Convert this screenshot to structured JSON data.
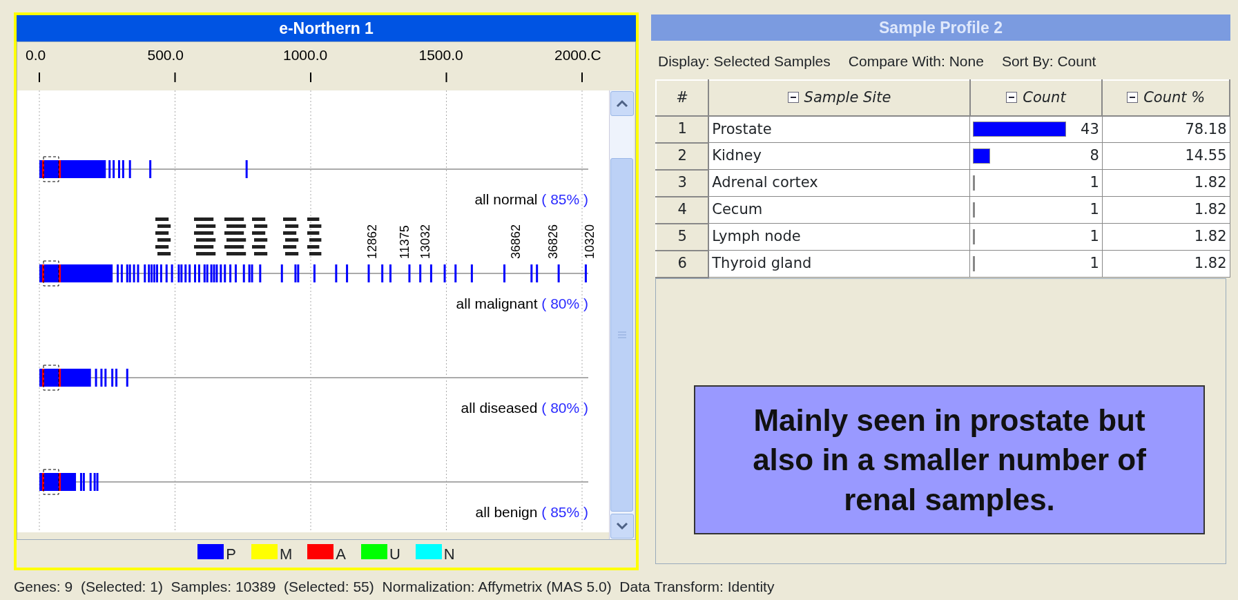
{
  "left_panel": {
    "title": "e-Northern 1",
    "selected": true,
    "axis_ticks": [
      "0.0",
      "500.0",
      "1000.0",
      "1500.0",
      "2000.C"
    ],
    "rows": [
      {
        "label": "all normal",
        "percent": "( 85% )"
      },
      {
        "label": "all malignant",
        "percent": "( 80% )"
      },
      {
        "label": "all diseased",
        "percent": "( 80% )"
      },
      {
        "label": "all benign",
        "percent": "( 85% )"
      }
    ],
    "point_labels": [
      "12862",
      "11375",
      "13032",
      "36862",
      "36826",
      "10320"
    ],
    "legend": [
      {
        "label": "P",
        "color": "#0000ff"
      },
      {
        "label": "M",
        "color": "#ffff00"
      },
      {
        "label": "A",
        "color": "#ff0000"
      },
      {
        "label": "U",
        "color": "#00ff00"
      },
      {
        "label": "N",
        "color": "#00ffff"
      }
    ]
  },
  "right_panel": {
    "title": "Sample Profile 2",
    "selected": false,
    "options": [
      "Display: Selected Samples",
      "Compare With: None",
      "Sort By: Count"
    ],
    "columns": [
      "#",
      "Sample Site",
      "Count",
      "Count %"
    ],
    "rows": [
      {
        "index": "1",
        "site": "Prostate",
        "count": "43",
        "percent": "78.18"
      },
      {
        "index": "2",
        "site": "Kidney",
        "count": "8",
        "percent": "14.55"
      },
      {
        "index": "3",
        "site": "Adrenal cortex",
        "count": "1",
        "percent": "1.82"
      },
      {
        "index": "4",
        "site": "Cecum",
        "count": "1",
        "percent": "1.82"
      },
      {
        "index": "5",
        "site": "Lymph node",
        "count": "1",
        "percent": "1.82"
      },
      {
        "index": "6",
        "site": "Thyroid gland",
        "count": "1",
        "percent": "1.82"
      }
    ]
  },
  "callout": "Mainly seen in prostate but also in a smaller number of renal samples.",
  "status_bar": "Genes: 9  (Selected: 1)  Samples: 10389  (Selected: 55)  Normalization: Affymetrix (MAS 5.0)  Data Transform: Identity"
}
